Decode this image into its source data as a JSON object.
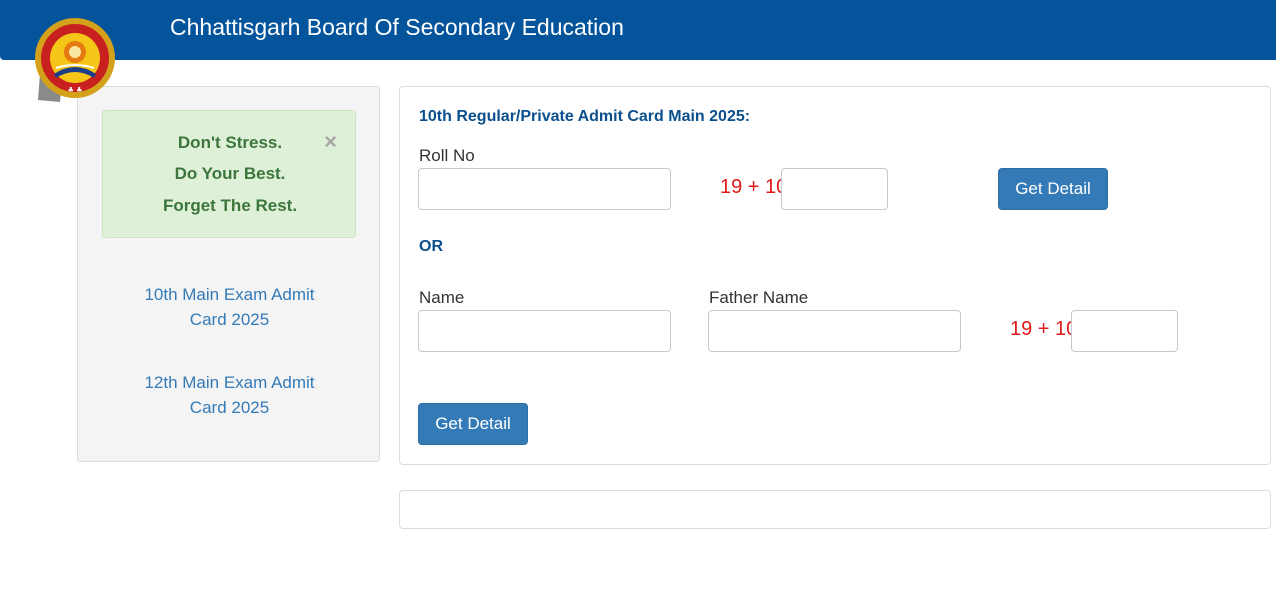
{
  "header": {
    "title": "Chhattisgarh Board Of Secondary Education"
  },
  "sidebar": {
    "alert": {
      "line1": "Don't Stress.",
      "line2": "Do Your Best.",
      "line3": "Forget The Rest.",
      "close": "×"
    },
    "links": [
      {
        "line1": "10th Main Exam Admit",
        "line2": "Card 2025"
      },
      {
        "line1": "12th Main Exam Admit",
        "line2": "Card 2025"
      }
    ]
  },
  "form": {
    "heading": "10th Regular/Private Admit Card Main 2025:",
    "roll_label": "Roll No",
    "roll_value": "",
    "captcha1_text": "19 + 10",
    "captcha1_value": "",
    "button1_label": "Get Detail",
    "or_label": "OR",
    "name_label": "Name",
    "name_value": "",
    "father_label": "Father Name",
    "father_value": "",
    "captcha2_text": "19 + 10",
    "captcha2_value": "",
    "button2_label": "Get Detail"
  },
  "colors": {
    "header_bg": "#04549b",
    "accent": "#337ab7",
    "alert_bg": "#dff0d8",
    "alert_text": "#3c763d",
    "captcha_text": "#e01919"
  }
}
